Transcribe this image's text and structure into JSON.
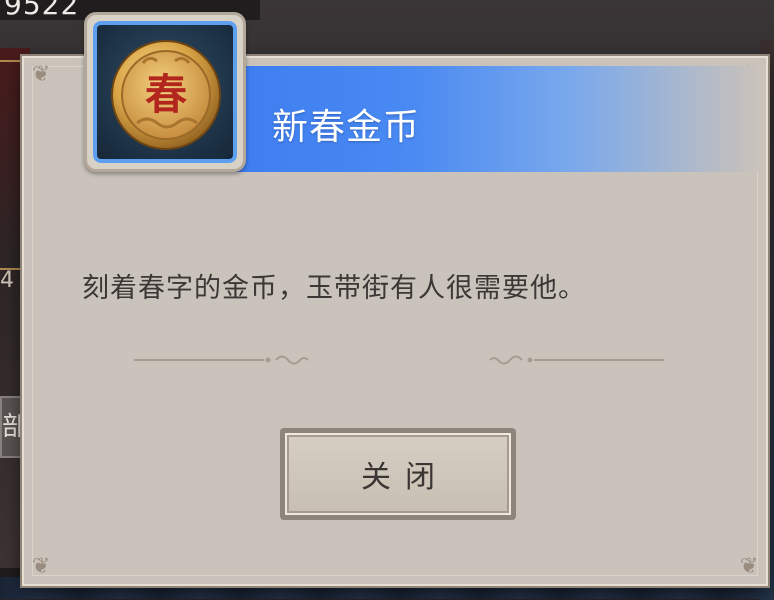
{
  "background": {
    "counter_text": "9522",
    "left_glyph": "4",
    "left_tab_text": "部"
  },
  "dialog": {
    "item": {
      "name": "新春金币",
      "icon": "spring-gold-coin-icon",
      "coin_glyph": "春"
    },
    "description": "刻着春字的金币，玉带街有人很需要他。",
    "close_button_label": "关闭"
  },
  "colors": {
    "banner_blue": "#3d7df0",
    "dialog_bg": "#cac3bc",
    "coin_red": "#b3261e",
    "coin_gold": "#d9a446"
  }
}
